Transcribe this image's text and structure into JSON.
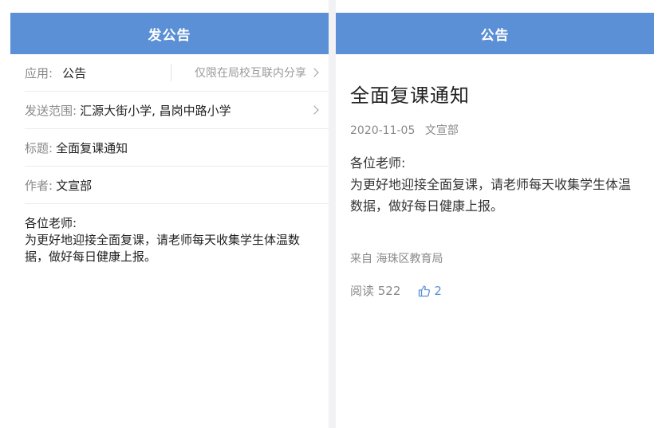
{
  "left": {
    "navbar_title": "发公告",
    "app_row": {
      "label": "应用:",
      "value": "公告",
      "note": "仅限在局校互联内分享"
    },
    "scope_row": {
      "label": "发送范围:",
      "value": "汇源大街小学, 昌岗中路小学"
    },
    "title_row": {
      "label": "标题:",
      "value": "全面复课通知"
    },
    "author_row": {
      "label": "作者:",
      "value": "文宣部"
    },
    "body_lines": [
      "各位老师:",
      "为更好地迎接全面复课，请老师每天收集学生体温数据，做好每日健康上报。"
    ]
  },
  "right": {
    "navbar_title": "公告",
    "title": "全面复课通知",
    "date": "2020-11-05",
    "author": "文宣部",
    "content_lines": [
      "各位老师:",
      "为更好地迎接全面复课，请老师每天收集学生体温数据，做好每日健康上报。"
    ],
    "source": "来自 海珠区教育局",
    "reads": "阅读 522",
    "likes": "2"
  },
  "colors": {
    "navbar": "#5b8fd6",
    "muted": "#8a8a8a",
    "accent": "#5b8fd6"
  },
  "icons": {
    "chevron": "chevron-right-icon",
    "like": "thumbs-up-icon"
  }
}
